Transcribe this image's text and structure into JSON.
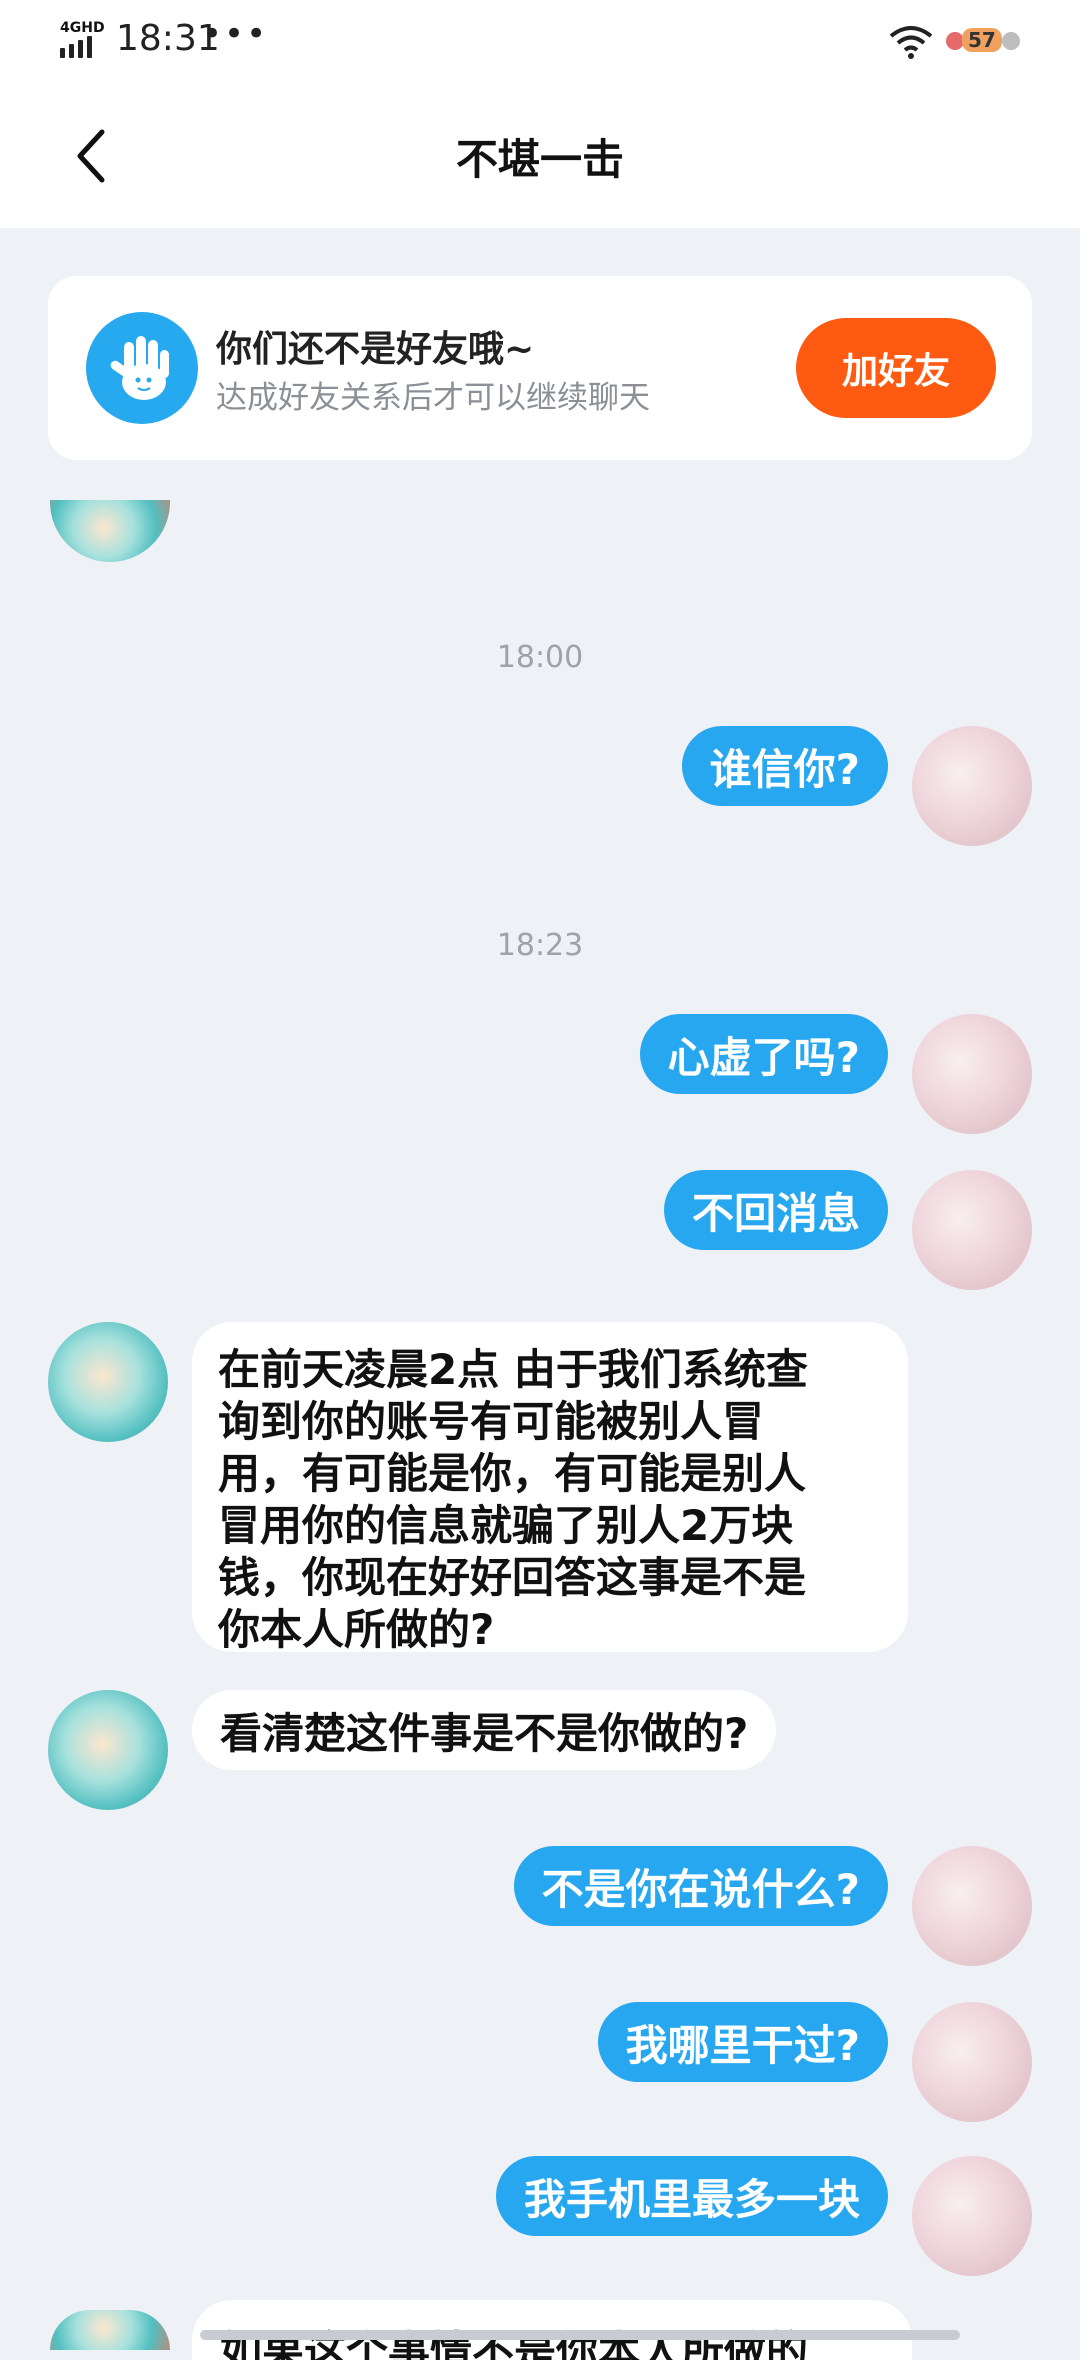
{
  "status_bar": {
    "network": "4GHD",
    "time": "18:31",
    "more": "•••",
    "battery": "57"
  },
  "header": {
    "title": "不堪一击"
  },
  "friend_card": {
    "title": "你们还不是好友哦~",
    "subtitle": "达成好友关系后才可以继续聊天",
    "add_button": "加好友"
  },
  "messages": [
    {
      "type": "time",
      "text": "18:00"
    },
    {
      "type": "me",
      "text": "谁信你?"
    },
    {
      "type": "time",
      "text": "18:23"
    },
    {
      "type": "me",
      "text": "心虚了吗?"
    },
    {
      "type": "me",
      "text": "不回消息"
    },
    {
      "type": "other",
      "lines": [
        "在前天凌晨2点 由于我们系统查",
        "询到你的账号有可能被别人冒",
        "用，有可能是你，有可能是别人",
        "冒用你的信息就骗了别人2万块",
        "钱，你现在好好回答这事是不是",
        "你本人所做的?"
      ]
    },
    {
      "type": "other",
      "text": "看清楚这件事是不是你做的?"
    },
    {
      "type": "me",
      "text": "不是你在说什么?"
    },
    {
      "type": "me",
      "text": "我哪里干过?"
    },
    {
      "type": "me",
      "text": "我手机里最多一块"
    },
    {
      "type": "other_partial",
      "text": "如果这个事情不是你本人所做的"
    }
  ],
  "colors": {
    "me_bubble": "#27a7ef",
    "add_button": "#fe5a12",
    "background": "#eef1f6"
  }
}
